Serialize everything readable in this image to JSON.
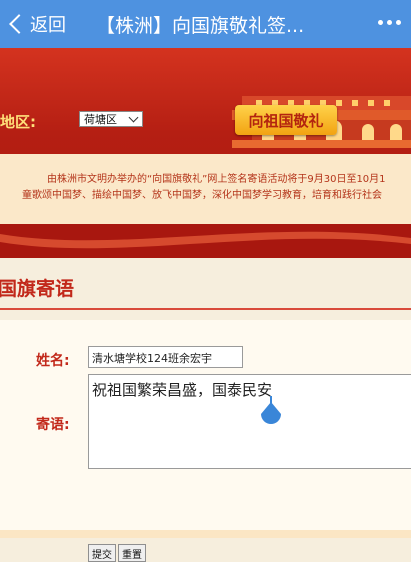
{
  "topbar": {
    "back_label": "返回",
    "title": "【株洲】向国旗敬礼签..."
  },
  "banner": {
    "region_label": "地区:",
    "region_selected": "荷塘区",
    "salute_button": "向祖国敬礼",
    "intro_line1": "由株洲市文明办举办的“向国旗敬礼”网上签名寄语活动将于9月30日至10月1",
    "intro_line2": "童歌颂中国梦、描绘中国梦、放飞中国梦，深化中国梦学习教育，培育和践行社会"
  },
  "section": {
    "title": "国旗寄语",
    "name_label": "姓名:",
    "name_value": "清水塘学校124班余宏宇",
    "message_label": "寄语:",
    "message_value": "祝祖国繁荣昌盛，国泰民安",
    "submit_label": "提交",
    "reset_label": "重置"
  },
  "colors": {
    "topbar": "#4e92e0",
    "banner_red": "#b51f13",
    "accent_gold": "#f2a312",
    "label_red": "#c2281a"
  }
}
